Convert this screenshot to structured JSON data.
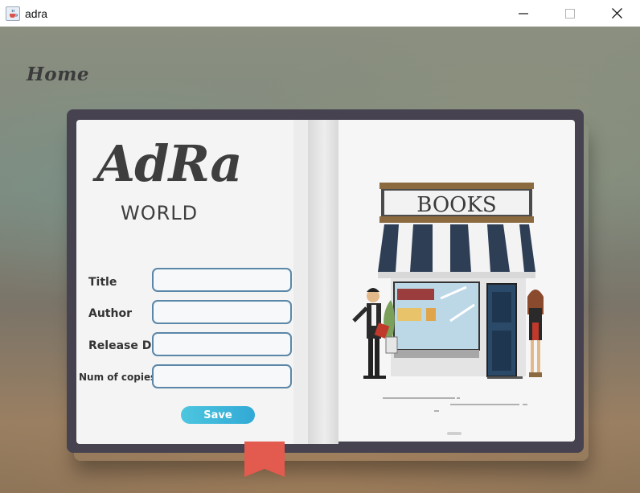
{
  "window": {
    "title": "adra",
    "icon": "java-cup-icon",
    "controls": [
      "minimize-icon",
      "maximize-icon",
      "close-icon"
    ]
  },
  "nav": {
    "home_label": "Home"
  },
  "logo": {
    "main": "AdRa",
    "sub": "WORLD"
  },
  "form": {
    "fields": [
      {
        "label": "Title",
        "value": ""
      },
      {
        "label": "Author",
        "value": ""
      },
      {
        "label": "Release D",
        "value": ""
      },
      {
        "label": "Num of copies",
        "value": ""
      }
    ],
    "save_label": "Save"
  },
  "illustration": {
    "sign_text": "BOOKS"
  },
  "colors": {
    "input_border": "#5a87a8",
    "save_button": "#3bb6da",
    "book_cover": "#46424f",
    "ribbon": "#e35a4e"
  }
}
